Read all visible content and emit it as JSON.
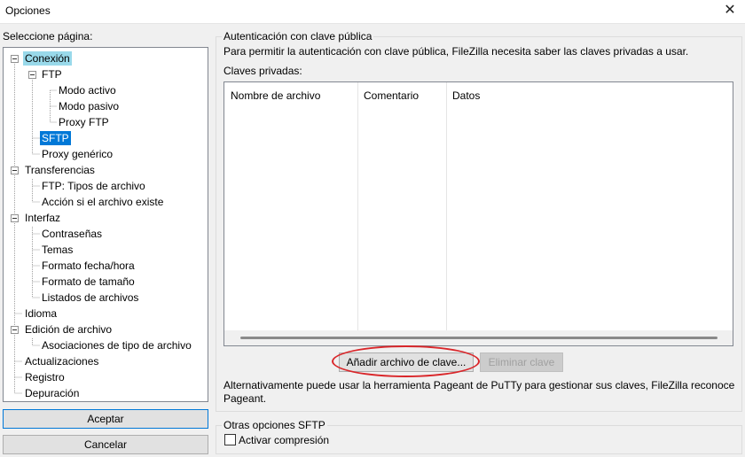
{
  "window": {
    "title": "Opciones"
  },
  "left": {
    "select_label": "Seleccione página:",
    "tree": [
      {
        "label": "Conexión",
        "level": 0,
        "expanded": true
      },
      {
        "label": "FTP",
        "level": 1,
        "expanded": true
      },
      {
        "label": "Modo activo",
        "level": 2
      },
      {
        "label": "Modo pasivo",
        "level": 2
      },
      {
        "label": "Proxy FTP",
        "level": 2
      },
      {
        "label": "SFTP",
        "level": 1
      },
      {
        "label": "Proxy genérico",
        "level": 1
      },
      {
        "label": "Transferencias",
        "level": 0,
        "expanded": true
      },
      {
        "label": "FTP: Tipos de archivo",
        "level": 1
      },
      {
        "label": "Acción si el archivo existe",
        "level": 1
      },
      {
        "label": "Interfaz",
        "level": 0,
        "expanded": true
      },
      {
        "label": "Contraseñas",
        "level": 1
      },
      {
        "label": "Temas",
        "level": 1
      },
      {
        "label": "Formato fecha/hora",
        "level": 1
      },
      {
        "label": "Formato de tamaño",
        "level": 1
      },
      {
        "label": "Listados de archivos",
        "level": 1
      },
      {
        "label": "Idioma",
        "level": 0
      },
      {
        "label": "Edición de archivo",
        "level": 0,
        "expanded": true
      },
      {
        "label": "Asociaciones de tipo de archivo",
        "level": 1
      },
      {
        "label": "Actualizaciones",
        "level": 0
      },
      {
        "label": "Registro",
        "level": 0
      },
      {
        "label": "Depuración",
        "level": 0
      }
    ],
    "accept_label": "Aceptar",
    "cancel_label": "Cancelar"
  },
  "pubkey": {
    "group_title": "Autenticación con clave pública",
    "description": "Para permitir la autenticación con clave pública, FileZilla necesita saber las claves privadas a usar.",
    "private_keys_label": "Claves privadas:",
    "columns": [
      "Nombre de archivo",
      "Comentario",
      "Datos"
    ],
    "add_key_label": "Añadir archivo de clave...",
    "remove_key_label": "Eliminar clave",
    "pageant_note_line1": "Alternativamente puede usar la herramienta Pageant de PuTTy para gestionar sus claves, FileZilla reconoce",
    "pageant_note_line2": "Pageant."
  },
  "sftp_other": {
    "group_title": "Otras opciones SFTP",
    "compression_label": "Activar compresión",
    "compression_checked": false
  },
  "colors": {
    "selected_focus": "#99d9ea",
    "selected": "#0078d7",
    "annotation": "#d9262a"
  }
}
